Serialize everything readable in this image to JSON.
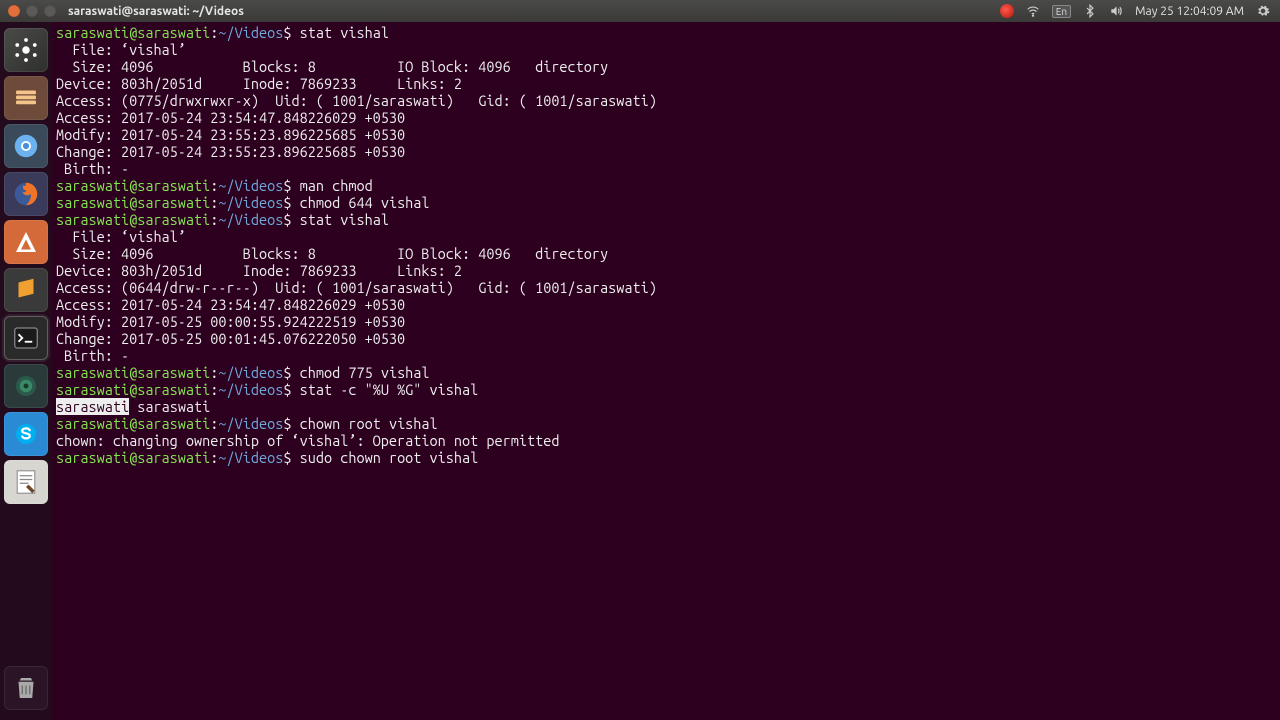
{
  "menubar": {
    "title": "saraswati@saraswati: ~/Videos",
    "lang": "En",
    "clock": "May 25 12:04:09 AM"
  },
  "prompt": {
    "userhost": "saraswati@saraswati",
    "sep": ":",
    "path": "~/Videos",
    "symbol": "$"
  },
  "lines": [
    {
      "t": "prompt",
      "cmd": "stat vishal"
    },
    {
      "t": "out",
      "text": "  File: ‘vishal’"
    },
    {
      "t": "out",
      "text": "  Size: 4096           Blocks: 8          IO Block: 4096   directory"
    },
    {
      "t": "out",
      "text": "Device: 803h/2051d     Inode: 7869233     Links: 2"
    },
    {
      "t": "out",
      "text": "Access: (0775/drwxrwxr-x)  Uid: ( 1001/saraswati)   Gid: ( 1001/saraswati)"
    },
    {
      "t": "out",
      "text": "Access: 2017-05-24 23:54:47.848226029 +0530"
    },
    {
      "t": "out",
      "text": "Modify: 2017-05-24 23:55:23.896225685 +0530"
    },
    {
      "t": "out",
      "text": "Change: 2017-05-24 23:55:23.896225685 +0530"
    },
    {
      "t": "out",
      "text": " Birth: -"
    },
    {
      "t": "prompt",
      "cmd": "man chmod"
    },
    {
      "t": "prompt",
      "cmd": "chmod 644 vishal"
    },
    {
      "t": "prompt",
      "cmd": "stat vishal"
    },
    {
      "t": "out",
      "text": "  File: ‘vishal’"
    },
    {
      "t": "out",
      "text": "  Size: 4096           Blocks: 8          IO Block: 4096   directory"
    },
    {
      "t": "out",
      "text": "Device: 803h/2051d     Inode: 7869233     Links: 2"
    },
    {
      "t": "out",
      "text": "Access: (0644/drw-r--r--)  Uid: ( 1001/saraswati)   Gid: ( 1001/saraswati)"
    },
    {
      "t": "out",
      "text": "Access: 2017-05-24 23:54:47.848226029 +0530"
    },
    {
      "t": "out",
      "text": "Modify: 2017-05-25 00:00:55.924222519 +0530"
    },
    {
      "t": "out",
      "text": "Change: 2017-05-25 00:01:45.076222050 +0530"
    },
    {
      "t": "out",
      "text": " Birth: -"
    },
    {
      "t": "prompt",
      "cmd": "chmod 775 vishal"
    },
    {
      "t": "prompt",
      "cmd": "stat -c \"%U %G\" vishal"
    },
    {
      "t": "selout",
      "sel": "saraswati",
      "rest": " saraswati"
    },
    {
      "t": "prompt",
      "cmd": "chown root vishal"
    },
    {
      "t": "out",
      "text": "chown: changing ownership of ‘vishal’: Operation not permitted"
    },
    {
      "t": "prompt",
      "cmd": "sudo chown root vishal"
    }
  ]
}
